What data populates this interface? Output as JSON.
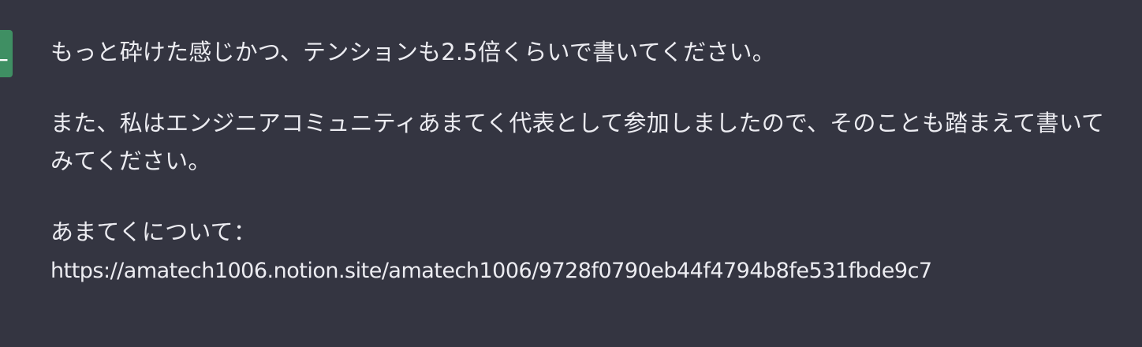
{
  "message": {
    "avatar_letter": "L",
    "accent_color": "#3f8f63",
    "paragraph_1": "もっと砕けた感じかつ、テンションも2.5倍くらいで書いてください。",
    "paragraph_2": "また、私はエンジニアコミュニティあまてく代表として参加しましたので、そのことも踏まえて書いてみてください。",
    "paragraph_3_label": "あまてくについて：",
    "paragraph_3_url": "https://amatech1006.notion.site/amatech1006/9728f0790eb44f4794b8fe531fbde9c7"
  }
}
